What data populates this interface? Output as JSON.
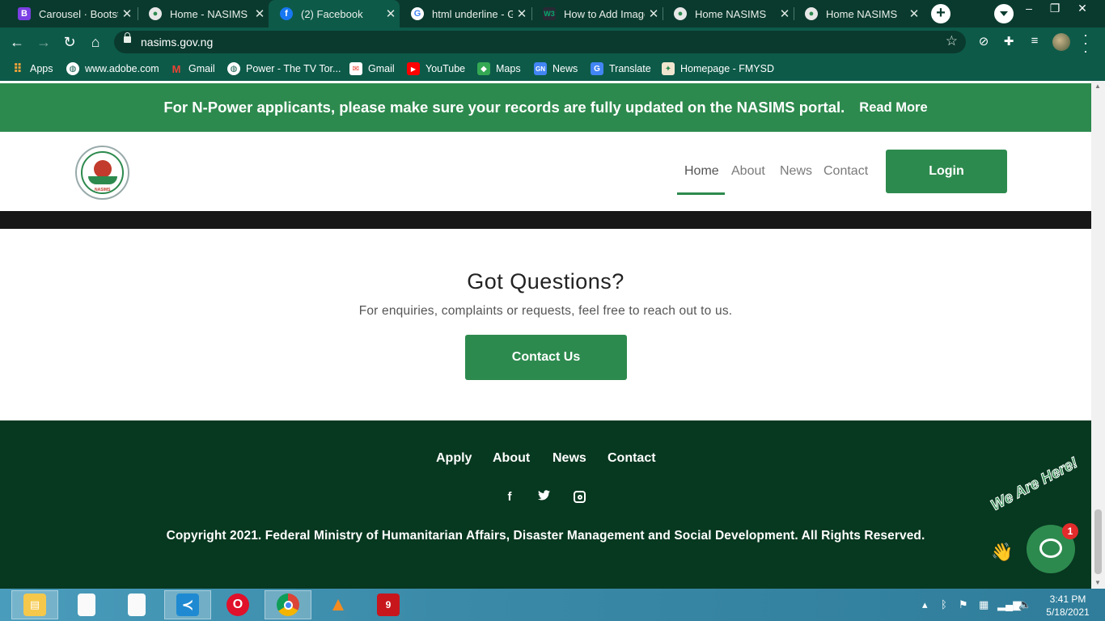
{
  "browser": {
    "tabs": [
      {
        "title": "Carousel · Bootstrap",
        "icon": "bootstrap-icon"
      },
      {
        "title": "Home - NASIMS",
        "icon": "nasims-favicon"
      },
      {
        "title": "(2) Facebook",
        "icon": "facebook-icon"
      },
      {
        "title": "html underline - Google",
        "icon": "google-icon"
      },
      {
        "title": "How to Add Image",
        "icon": "w3-icon"
      },
      {
        "title": "Home NASIMS",
        "icon": "nasims-favicon"
      },
      {
        "title": "Home NASIMS",
        "icon": "nasims-favicon"
      }
    ],
    "url": "nasims.gov.ng",
    "bookmarks": [
      {
        "label": "Apps",
        "icon": "apps-grid-icon"
      },
      {
        "label": "www.adobe.com",
        "icon": "globe-icon"
      },
      {
        "label": "Gmail",
        "icon": "gmail-icon"
      },
      {
        "label": "Power - The TV Tor...",
        "icon": "globe-icon"
      },
      {
        "label": "Gmail",
        "icon": "mail-icon"
      },
      {
        "label": "YouTube",
        "icon": "youtube-icon"
      },
      {
        "label": "Maps",
        "icon": "maps-icon"
      },
      {
        "label": "News",
        "icon": "news-icon"
      },
      {
        "label": "Translate",
        "icon": "translate-icon"
      },
      {
        "label": "Homepage - FMYSD",
        "icon": "fmysd-icon"
      }
    ]
  },
  "announcement": {
    "text": "For N-Power applicants, please make sure your records are fully updated on the NASIMS portal.",
    "link": "Read More"
  },
  "header": {
    "logo_text": "NASIMS",
    "nav": [
      "Home",
      "About",
      "News",
      "Contact"
    ],
    "active_nav": "Home",
    "login": "Login"
  },
  "questions": {
    "title": "Got Questions?",
    "subtitle": "For enquiries, complaints or requests, feel free to reach out to us.",
    "button": "Contact Us"
  },
  "footer": {
    "links": [
      "Apply",
      "About",
      "News",
      "Contact"
    ],
    "social": [
      "facebook-icon",
      "twitter-icon",
      "instagram-icon"
    ],
    "copyright": "Copyright 2021. Federal Ministry of Humanitarian Affairs, Disaster Management and Social Development. All Rights Reserved."
  },
  "chat": {
    "banner": "We Are Here!",
    "badge": "1"
  },
  "taskbar": {
    "time": "3:41 PM",
    "date": "5/18/2021"
  },
  "colors": {
    "brand_green": "#2d8a4e",
    "footer_green": "#073820",
    "chrome_dark": "#0a3a2e",
    "chrome_toolbar": "#0d5a49"
  }
}
